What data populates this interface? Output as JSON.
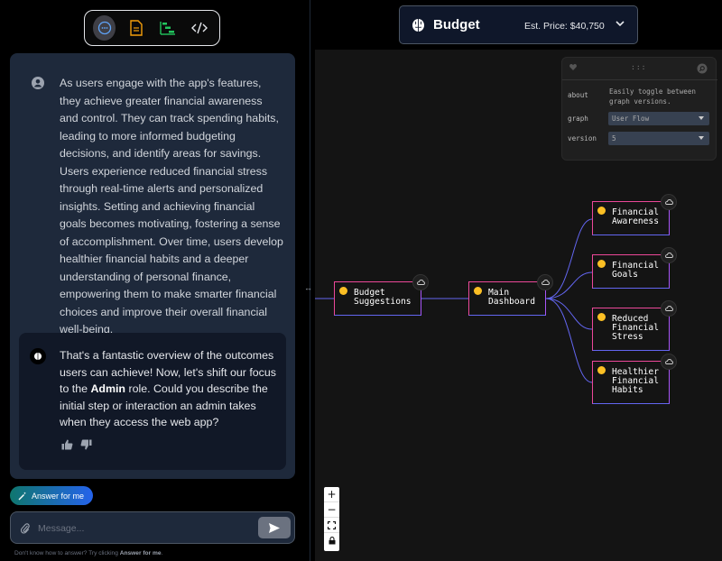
{
  "toolbar": {
    "tools": [
      {
        "name": "chat",
        "icon": "chat-bubble-icon",
        "active": true
      },
      {
        "name": "document",
        "icon": "document-icon",
        "active": false
      },
      {
        "name": "timeline",
        "icon": "gantt-icon",
        "active": false
      },
      {
        "name": "code",
        "icon": "code-icon",
        "active": false
      }
    ]
  },
  "chat": {
    "user_message": "As users engage with the app's features, they achieve greater financial awareness and control. They can track spending habits, leading to more informed budgeting decisions, and identify areas for savings. Users experience reduced financial stress through real-time alerts and personalized insights. Setting and achieving financial goals becomes motivating, fostering a sense of accomplishment. Over time, users develop healthier financial habits and a deeper understanding of personal finance, empowering them to make smarter financial choices and improve their overall financial well-being.",
    "bot_message_before": "That's a fantastic overview of the outcomes users can achieve! Now, let's shift our focus to the ",
    "bot_message_bold": "Admin",
    "bot_message_after": " role. Could you describe the initial step or interaction an admin takes when they access the web app?"
  },
  "answer_button": {
    "label": "Answer for me"
  },
  "composer": {
    "placeholder": "Message..."
  },
  "hint": {
    "prefix": "Don't know how to answer? Try clicking ",
    "bold": "Answer for me",
    "suffix": "."
  },
  "header": {
    "title": "Budget",
    "price": "Est. Price: $40,750"
  },
  "config": {
    "rows": [
      {
        "label": "about",
        "value": "Easily toggle between graph versions."
      },
      {
        "label": "graph",
        "value": "User Flow"
      },
      {
        "label": "version",
        "value": "5"
      }
    ]
  },
  "graph": {
    "nodes": [
      {
        "id": "budget-suggestions",
        "label": "Budget\nSuggestions"
      },
      {
        "id": "main-dashboard",
        "label": "Main\nDashboard"
      },
      {
        "id": "financial-awareness",
        "label": "Financial\nAwareness"
      },
      {
        "id": "financial-goals",
        "label": "Financial\nGoals"
      },
      {
        "id": "reduced-financial-stress",
        "label": "Reduced\nFinancial\nStress"
      },
      {
        "id": "healthier-financial-habits",
        "label": "Healthier\nFinancial\nHabits"
      }
    ],
    "edges": [
      {
        "from": "budget-suggestions",
        "to": "main-dashboard"
      },
      {
        "from": "main-dashboard",
        "to": "financial-awareness"
      },
      {
        "from": "main-dashboard",
        "to": "financial-goals"
      },
      {
        "from": "main-dashboard",
        "to": "reduced-financial-stress"
      },
      {
        "from": "main-dashboard",
        "to": "healthier-financial-habits"
      }
    ]
  },
  "zoom_controls": {
    "zoom_in": "+",
    "zoom_out": "−"
  },
  "colors": {
    "accent": "#2563eb",
    "node_border": "#ec4899",
    "edge": "#6366f1"
  }
}
